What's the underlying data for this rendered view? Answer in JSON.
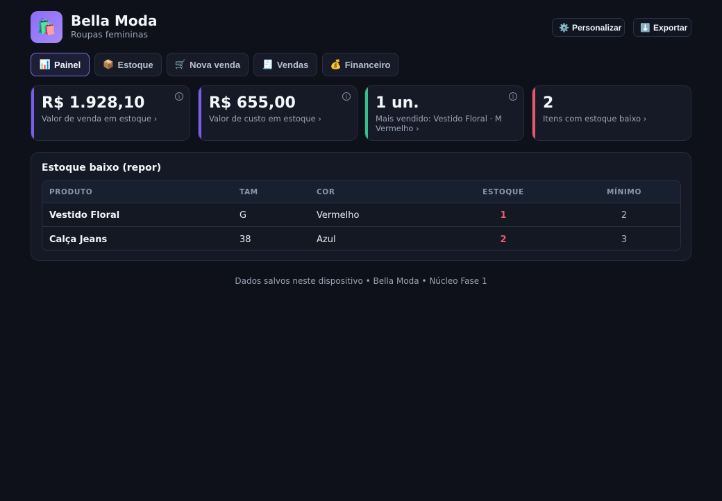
{
  "brand": {
    "name": "Bella Moda",
    "subtitle": "Roupas femininas",
    "logo_icon": "🛍️"
  },
  "header_actions": {
    "customize": {
      "icon": "⚙️",
      "label": "Personalizar"
    },
    "export": {
      "icon": "⬇️",
      "label": "Exportar"
    }
  },
  "tabs": [
    {
      "icon": "📊",
      "label": "Painel",
      "active": true
    },
    {
      "icon": "📦",
      "label": "Estoque",
      "active": false
    },
    {
      "icon": "🛒",
      "label": "Nova venda",
      "active": false
    },
    {
      "icon": "🧾",
      "label": "Vendas",
      "active": false
    },
    {
      "icon": "💰",
      "label": "Financeiro",
      "active": false
    }
  ],
  "stats": [
    {
      "value": "R$ 1.928,10",
      "label": "Valor de venda em estoque ›",
      "accent": "#7c5cf0",
      "info": true
    },
    {
      "value": "R$ 655,00",
      "label": "Valor de custo em estoque ›",
      "accent": "#7c5cf0",
      "info": true
    },
    {
      "value": "1 un.",
      "label": "Mais vendido: Vestido Floral · M Vermelho ›",
      "accent": "#36c08a",
      "info": true
    },
    {
      "value": "2",
      "label": "Itens com estoque baixo ›",
      "accent": "#e8566c",
      "info": false
    }
  ],
  "low_stock": {
    "title": "Estoque baixo (repor)",
    "columns": [
      "PRODUTO",
      "TAM",
      "COR",
      "ESTOQUE",
      "MÍNIMO"
    ],
    "rows": [
      {
        "produto": "Vestido Floral",
        "tam": "G",
        "cor": "Vermelho",
        "estoque": "1",
        "minimo": "2"
      },
      {
        "produto": "Calça Jeans",
        "tam": "38",
        "cor": "Azul",
        "estoque": "2",
        "minimo": "3"
      }
    ]
  },
  "footer": "Dados salvos neste dispositivo • Bella Moda • Núcleo Fase 1",
  "colors": {
    "background": "#0e1119",
    "accent": "#7c5cf0",
    "danger": "#ef5b6e",
    "success": "#36c08a"
  }
}
